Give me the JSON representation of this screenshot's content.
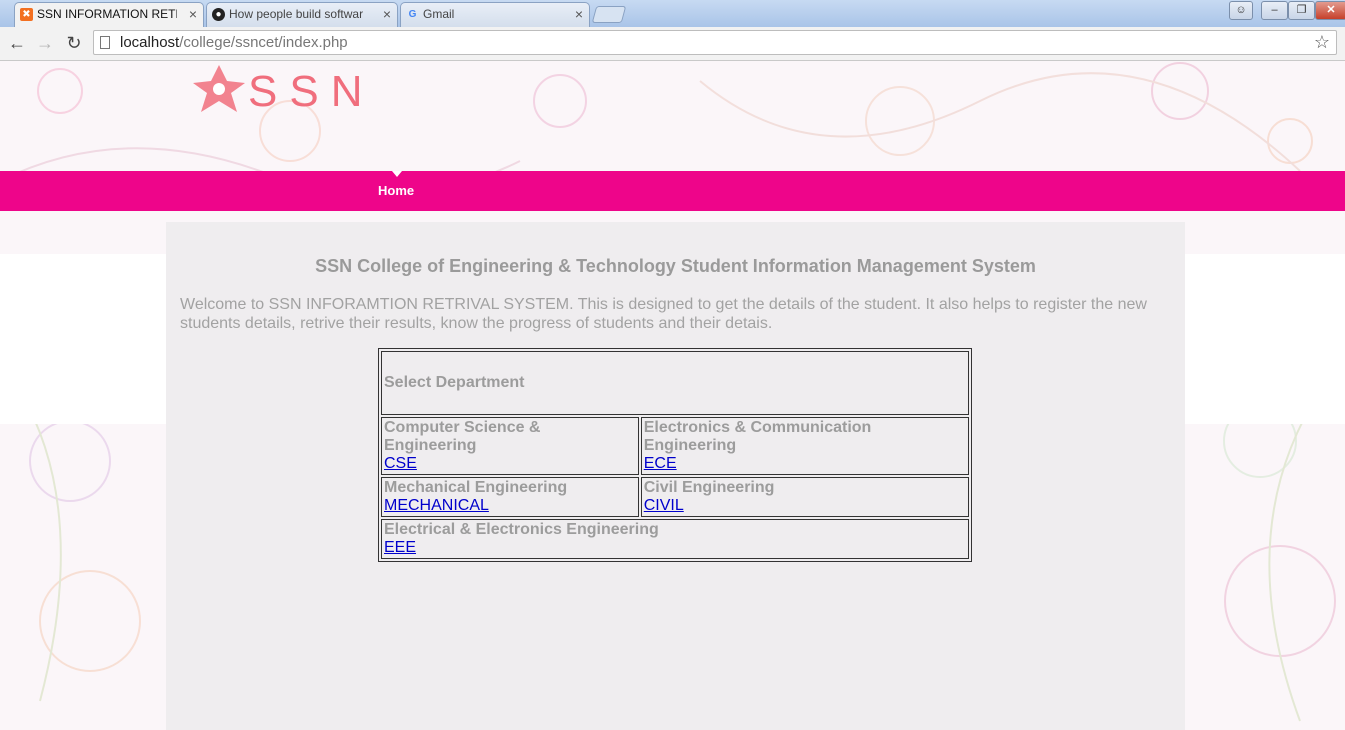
{
  "browser": {
    "tabs": [
      {
        "title": "SSN INFORMATION RETRI",
        "icon": "xampp-icon",
        "active": true
      },
      {
        "title": "How people build softwar",
        "icon": "github-icon",
        "active": false
      },
      {
        "title": "Gmail",
        "icon": "google-icon",
        "active": false
      }
    ],
    "address": {
      "host": "localhost",
      "path": "/college/ssncet/index.php"
    }
  },
  "page": {
    "logo_text": "SSN",
    "nav": {
      "home": "Home"
    },
    "title": "SSN College of Engineering & Technology Student Information Management System",
    "welcome": "Welcome to SSN INFORAMTION RETRIVAL SYSTEM. This is designed to get the details of the student. It also helps to register the new students details, retrive their results, know the progress of students and their detais.",
    "departments": {
      "heading": "Select Department",
      "items": [
        {
          "name": "Computer Science & Engineering",
          "link": "CSE"
        },
        {
          "name": "Electronics & Communication Engineering",
          "link": "ECE"
        },
        {
          "name": "Mechanical Engineering",
          "link": "MECHANICAL"
        },
        {
          "name": "Civil Engineering",
          "link": "CIVIL"
        },
        {
          "name": "Electrical & Electronics Engineering",
          "link": "EEE"
        }
      ]
    }
  },
  "colors": {
    "nav_bar": "#ee058a",
    "logo": "#f06e7d",
    "link": "#0000cc"
  }
}
